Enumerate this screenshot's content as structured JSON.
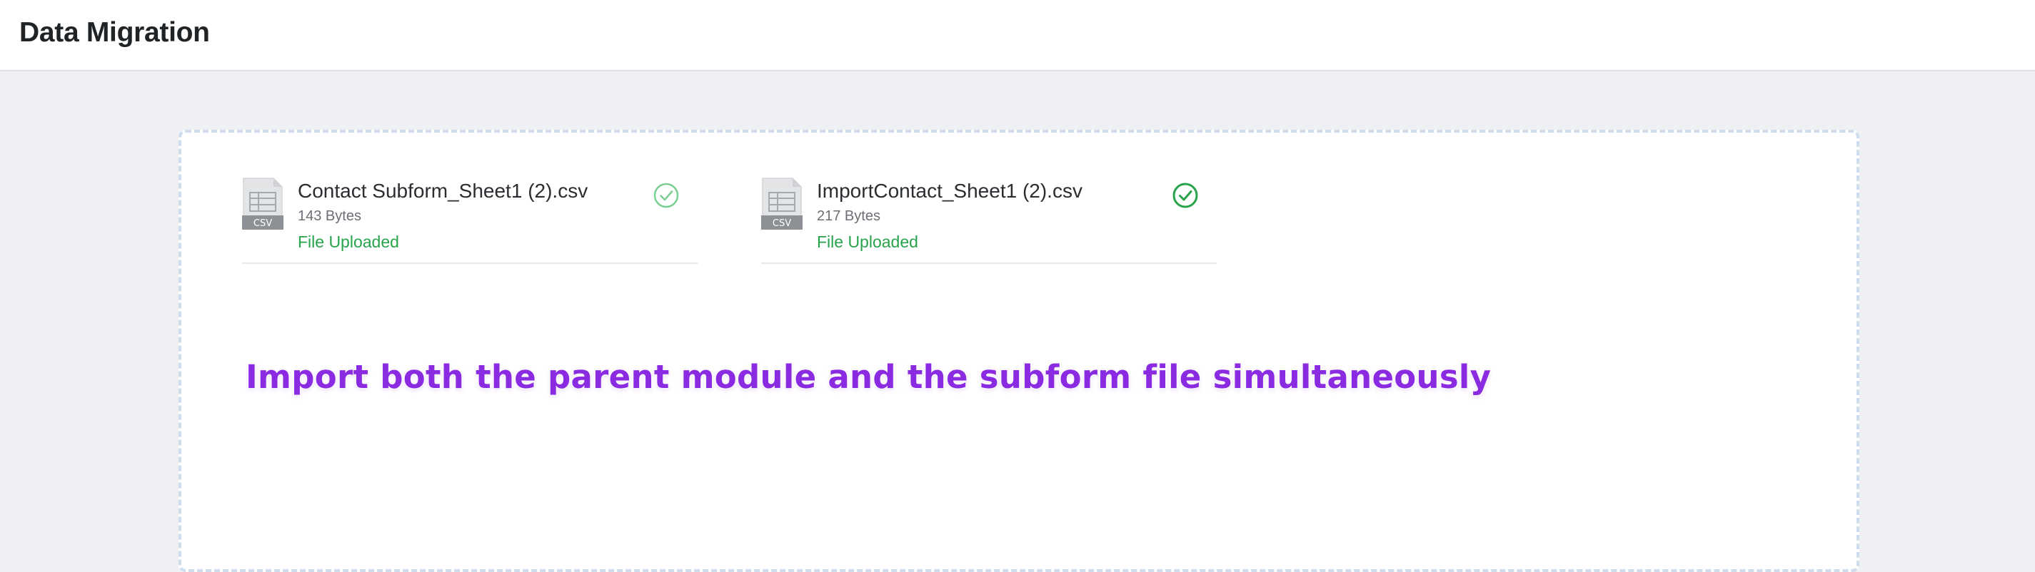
{
  "header": {
    "title": "Data Migration"
  },
  "files": [
    {
      "name": "Contact Subform_Sheet1 (2).csv",
      "size": "143 Bytes",
      "status": "File Uploaded",
      "type_label": "CSV",
      "check_style": "light"
    },
    {
      "name": "ImportContact_Sheet1 (2).csv",
      "size": "217 Bytes",
      "status": "File Uploaded",
      "type_label": "CSV",
      "check_style": "solid"
    }
  ],
  "caption": "Import both the parent module and the subform file simultaneously",
  "colors": {
    "success": "#26a34b",
    "success_light": "#7ccf92",
    "caption": "#8a2be2",
    "background": "#eef0f4",
    "dropzone_border": "#cfdcec"
  },
  "icons": {
    "file": "csv-file-icon",
    "status": "check-circle-icon"
  }
}
